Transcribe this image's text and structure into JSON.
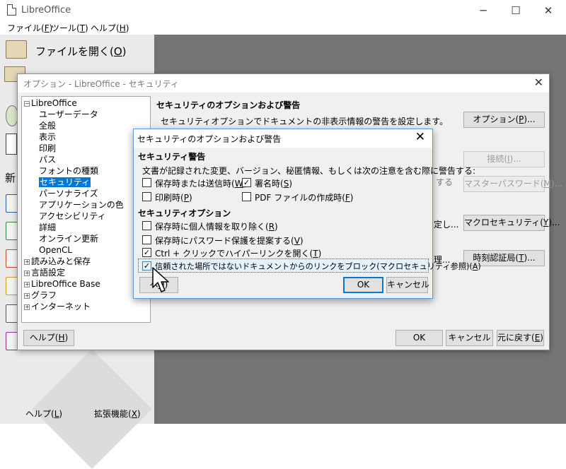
{
  "window": {
    "title": "LibreOffice",
    "controls": {
      "minimize": "─",
      "maximize": "☐",
      "close": "✕"
    }
  },
  "menubar": [
    {
      "label": "ファイル(",
      "key": "F",
      "suffix": ")"
    },
    {
      "label": "ツール(",
      "key": "T",
      "suffix": ")"
    },
    {
      "label": "ヘルプ(",
      "key": "H",
      "suffix": ")"
    }
  ],
  "start_center": {
    "open_file": {
      "pre": "ファイルを開く(",
      "key": "O",
      "post": ")"
    },
    "new_label": "新",
    "help_button": {
      "pre": "ヘルプ(",
      "key": "L",
      "post": ")"
    },
    "extensions_button": {
      "pre": "拡張機能(",
      "key": "X",
      "post": ")"
    }
  },
  "options_dialog": {
    "title": "オプション - LibreOffice - セキュリティ",
    "tree": {
      "root": "LibreOffice",
      "children": [
        "ユーザーデータ",
        "全般",
        "表示",
        "印刷",
        "パス",
        "フォントの種類",
        "セキュリティ",
        "パーソナライズ",
        "アプリケーションの色",
        "アクセシビリティ",
        "詳細",
        "オンライン更新",
        "OpenCL"
      ],
      "selected": "セキュリティ",
      "collapsed": [
        "読み込みと保存",
        "言語設定",
        "LibreOffice Base",
        "グラフ",
        "インターネット"
      ]
    },
    "panel": {
      "heading": "セキュリティのオプションおよび警告",
      "description": "セキュリティオプションでドキュメントの非表示情報の警告を設定します。",
      "options_button": {
        "pre": "オプション(",
        "key": "P",
        "post": ")..."
      },
      "connect_button": {
        "pre": "接続(",
        "key": "I",
        "post": ")..."
      },
      "master_password_button": {
        "pre": "マスターパスワード(",
        "key": "M",
        "post": ")..."
      },
      "macro_security_button": {
        "pre": "マクロセキュリティ(",
        "key": "Y",
        "post": ")..."
      },
      "tsa_button": {
        "pre": "時刻認証局(",
        "key": "T",
        "post": ")..."
      },
      "fragment_1": "する",
      "fragment_2": "定し...",
      "fragment_3": "理..."
    },
    "footer": {
      "help": {
        "pre": "ヘルプ(",
        "key": "H",
        "post": ")"
      },
      "ok": "OK",
      "cancel": "キャンセル",
      "reset": {
        "pre": "元に戻す(",
        "key": "E",
        "post": ")"
      }
    }
  },
  "security_dialog": {
    "title": "セキュリティのオプションおよび警告",
    "warnings_heading": "セキュリティ警告",
    "warnings_desc": "文書が記録された変更、バージョン、秘匿情報、もしくは次の注意を含む際に警告する:",
    "warnings": [
      {
        "pre": "保存時または送信時(",
        "key": "W",
        "post": ")",
        "checked": false
      },
      {
        "pre": "署名時(",
        "key": "S",
        "post": ")",
        "checked": true
      },
      {
        "pre": "印刷時(",
        "key": "P",
        "post": ")",
        "checked": false
      },
      {
        "pre": "PDF ファイルの作成時(",
        "key": "F",
        "post": ")",
        "checked": false
      }
    ],
    "options_heading": "セキュリティオプション",
    "options": [
      {
        "pre": "保存時に個人情報を取り除く(",
        "key": "R",
        "post": ")",
        "checked": false
      },
      {
        "pre": "保存時にパスワード保護を提案する(",
        "key": "V",
        "post": ")",
        "checked": false
      },
      {
        "pre": "Ctrl + クリックでハイパーリンクを開く(",
        "key": "T",
        "post": ")",
        "checked": true
      },
      {
        "pre": "信頼された場所ではないドキュメントからのリンクをブロック(マクロセキュリティ参照)(",
        "key": "A",
        "post": ")",
        "checked": true
      }
    ],
    "help": {
      "pre": "ヘ",
      "key": "H",
      "post": ")"
    },
    "ok": "OK",
    "cancel": "キャンセル"
  }
}
